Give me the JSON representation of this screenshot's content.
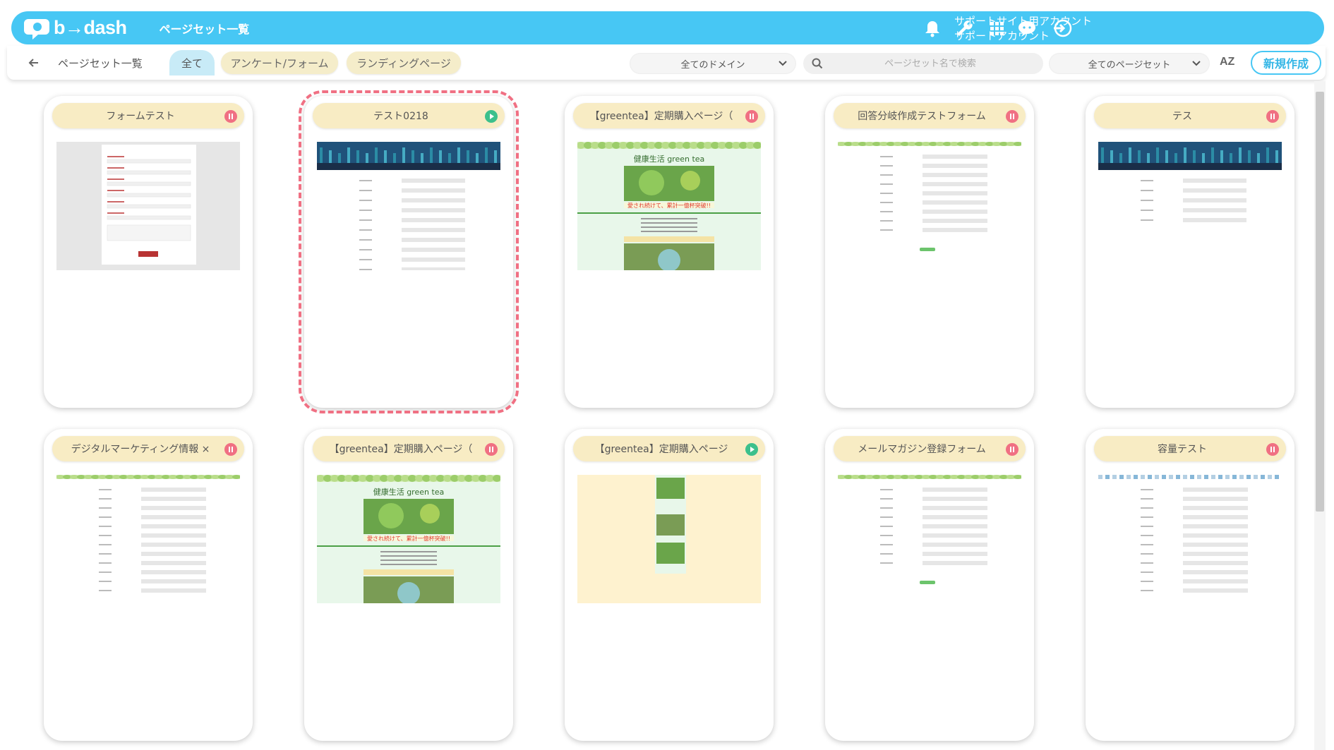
{
  "header": {
    "logo_text": "b→dash",
    "page_title": "ページセット一覧",
    "account_line1": "サポートサイト用アカウント",
    "account_line2": "サポートアカウント",
    "icons": [
      "bell-icon",
      "wrench-icon",
      "grid-icon",
      "chat-icon",
      "logout-icon"
    ]
  },
  "subnav": {
    "breadcrumb": "ページセット一覧",
    "tabs": [
      {
        "label": "全て",
        "active": true
      },
      {
        "label": "アンケート/フォーム",
        "active": false
      },
      {
        "label": "ランディングページ",
        "active": false
      }
    ],
    "domain_select": "全てのドメイン",
    "search_placeholder": "ページセット名で検索",
    "pageset_select": "全てのページセット",
    "sort_label": "AZ",
    "new_button": "新規作成"
  },
  "cards": [
    {
      "title": "フォームテスト",
      "status": "paused",
      "thumb": "form-gray"
    },
    {
      "title": "テスト0218",
      "status": "live",
      "thumb": "form-banner",
      "selected": true
    },
    {
      "title": "【greentea】定期購入ページ（",
      "status": "paused",
      "thumb": "greentea"
    },
    {
      "title": "回答分岐作成テストフォーム",
      "status": "paused",
      "thumb": "form-green"
    },
    {
      "title": "テス",
      "status": "paused",
      "thumb": "form-banner-short"
    },
    {
      "title": "デジタルマーケティング情報 ×",
      "status": "paused",
      "thumb": "form-green-long"
    },
    {
      "title": "【greentea】定期購入ページ（",
      "status": "paused",
      "thumb": "greentea"
    },
    {
      "title": "【greentea】定期購入ページ",
      "status": "live",
      "thumb": "greentea-small"
    },
    {
      "title": "メールマガジン登録フォーム",
      "status": "paused",
      "thumb": "form-green"
    },
    {
      "title": "容量テスト",
      "status": "paused",
      "thumb": "form-long"
    }
  ],
  "colors": {
    "header_bg": "#47c7f4",
    "card_title_bg": "#f8ecc4",
    "paused": "#f07083",
    "live": "#3cc08c",
    "selected_outline": "#f07083"
  }
}
